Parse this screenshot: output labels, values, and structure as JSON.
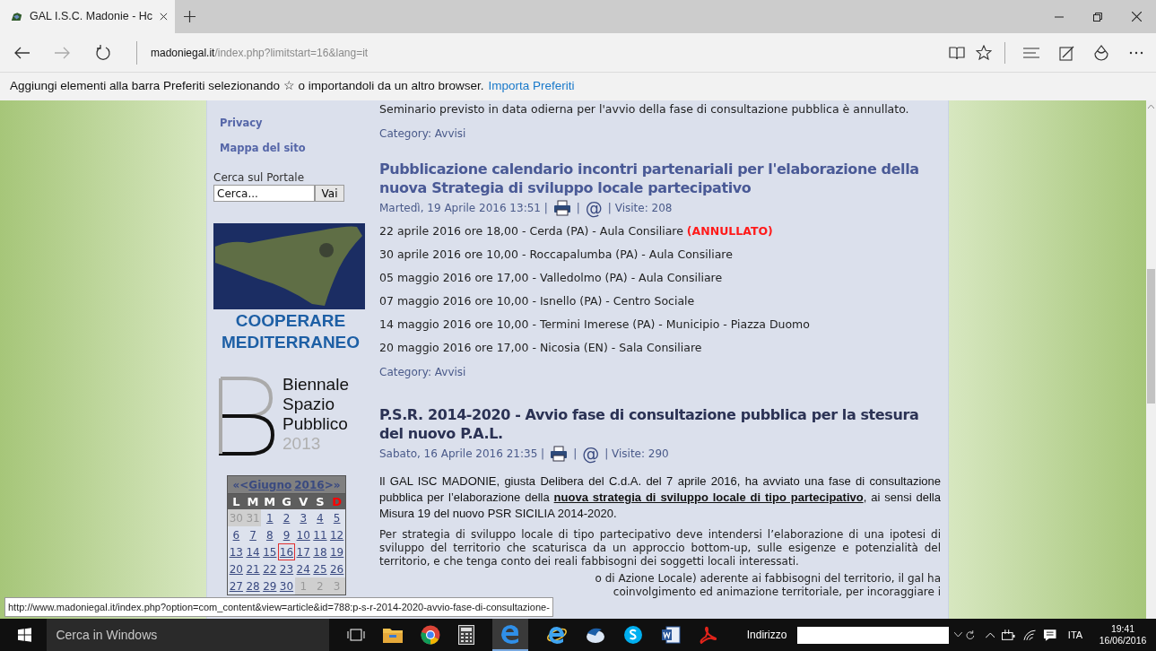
{
  "browser": {
    "tab": {
      "title": "GAL I.S.C. Madonie - Hc"
    },
    "address": {
      "domain": "madoniegal.it",
      "path": "/index.php?limitstart=16&lang=it"
    },
    "favorites_bar": {
      "message": "Aggiungi elementi alla barra Preferiti selezionando ☆ o importandoli da un altro browser.",
      "link": "Importa Preferiti"
    }
  },
  "sidebar": {
    "links": [
      "Privacy",
      "Mappa del sito"
    ],
    "search": {
      "label": "Cerca sul Portale",
      "value": "Cerca...",
      "button": "Vai"
    },
    "banner_text": "COOPERARE MEDITERRANEO",
    "biennale": {
      "lines": [
        "Biennale",
        "Spazio",
        "Pubblico"
      ],
      "year": "2013"
    },
    "calendar": {
      "nav": [
        "«",
        "<"
      ],
      "month": "Giugno",
      "year": "2016",
      "nav_end": [
        ">",
        "»"
      ],
      "weekdays": [
        {
          "label": "L",
          "color": "#ffffff"
        },
        {
          "label": "M",
          "color": "#ffffff"
        },
        {
          "label": "M",
          "color": "#ffffff"
        },
        {
          "label": "G",
          "color": "#ffffff"
        },
        {
          "label": "V",
          "color": "#ffffff"
        },
        {
          "label": "S",
          "color": "#ffffff"
        },
        {
          "label": "D",
          "color": "#ff0000"
        }
      ],
      "weeks": [
        [
          {
            "day": "30",
            "kind": "other",
            "selected": false
          },
          {
            "day": "31",
            "kind": "other",
            "selected": false
          },
          {
            "day": "1",
            "kind": "current",
            "selected": false
          },
          {
            "day": "2",
            "kind": "current",
            "selected": false
          },
          {
            "day": "3",
            "kind": "current",
            "selected": false
          },
          {
            "day": "4",
            "kind": "current",
            "selected": false
          },
          {
            "day": "5",
            "kind": "current",
            "selected": false
          }
        ],
        [
          {
            "day": "6",
            "kind": "current",
            "selected": false
          },
          {
            "day": "7",
            "kind": "current",
            "selected": false
          },
          {
            "day": "8",
            "kind": "current",
            "selected": false
          },
          {
            "day": "9",
            "kind": "current",
            "selected": false
          },
          {
            "day": "10",
            "kind": "current",
            "selected": false
          },
          {
            "day": "11",
            "kind": "current",
            "selected": false
          },
          {
            "day": "12",
            "kind": "current",
            "selected": false
          }
        ],
        [
          {
            "day": "13",
            "kind": "current",
            "selected": false
          },
          {
            "day": "14",
            "kind": "current",
            "selected": false
          },
          {
            "day": "15",
            "kind": "current",
            "selected": false
          },
          {
            "day": "16",
            "kind": "current",
            "selected": true
          },
          {
            "day": "17",
            "kind": "current",
            "selected": false
          },
          {
            "day": "18",
            "kind": "current",
            "selected": false
          },
          {
            "day": "19",
            "kind": "current",
            "selected": false
          }
        ],
        [
          {
            "day": "20",
            "kind": "current",
            "selected": false
          },
          {
            "day": "21",
            "kind": "current",
            "selected": false
          },
          {
            "day": "22",
            "kind": "current",
            "selected": false
          },
          {
            "day": "23",
            "kind": "current",
            "selected": false
          },
          {
            "day": "24",
            "kind": "current",
            "selected": false
          },
          {
            "day": "25",
            "kind": "current",
            "selected": false
          },
          {
            "day": "26",
            "kind": "current",
            "selected": false
          }
        ],
        [
          {
            "day": "27",
            "kind": "current",
            "selected": false
          },
          {
            "day": "28",
            "kind": "current",
            "selected": false
          },
          {
            "day": "29",
            "kind": "current",
            "selected": false
          },
          {
            "day": "30",
            "kind": "current",
            "selected": false
          },
          {
            "day": "1",
            "kind": "other",
            "selected": false
          },
          {
            "day": "2",
            "kind": "other",
            "selected": false
          },
          {
            "day": "3",
            "kind": "other",
            "selected": false
          }
        ]
      ]
    }
  },
  "articles": [
    {
      "body_tail": "Seminario previsto in data odierna per l'avvio della fase di consultazione pubblica è annullato.",
      "category": "Category: Avvisi"
    },
    {
      "title": "Pubblicazione calendario incontri partenariali per l'elaborazione della nuova Strategia di sviluppo locale partecipativo",
      "hovered": false,
      "meta": [
        {
          "kind": "text",
          "text": "Martedì, 19 Aprile 2016 13:51 |"
        },
        {
          "kind": "print"
        },
        {
          "kind": "text",
          "text": "|"
        },
        {
          "kind": "email",
          "text": "@"
        },
        {
          "kind": "text",
          "text": "| Visite: 208"
        }
      ],
      "meetings": [
        {
          "text": "22 aprile 2016 ore 18,00 - Cerda (PA) - Aula Consiliare",
          "note": "(ANNULLATO)"
        },
        {
          "text": "30 aprile 2016 ore 10,00 - Roccapalumba (PA) - Aula Consiliare"
        },
        {
          "text": "05 maggio 2016 ore 17,00 - Valledolmo (PA) - Aula Consiliare"
        },
        {
          "text": "07 maggio 2016 ore 10,00 - Isnello (PA) - Centro Sociale"
        },
        {
          "text": "14 maggio 2016 ore 10,00 - Termini Imerese (PA) - Municipio - Piazza Duomo"
        },
        {
          "text": "20 maggio 2016 ore 17,00 - Nicosia (EN) - Sala Consiliare"
        }
      ],
      "category": "Category: Avvisi"
    },
    {
      "title": "P.S.R. 2014-2020 - Avvio fase di consultazione pubblica per la stesura del nuovo P.A.L.",
      "hovered": true,
      "meta": [
        {
          "kind": "text",
          "text": "Sabato, 16 Aprile 2016 21:35 |"
        },
        {
          "kind": "print"
        },
        {
          "kind": "text",
          "text": "|"
        },
        {
          "kind": "email",
          "text": "@"
        },
        {
          "kind": "text",
          "text": "| Visite: 290"
        }
      ],
      "lead": {
        "before": "Il GAL ISC MADONIE, giusta Delibera del C.d.A. del 7 aprile 2016, ha avviato una fase di consultazione pubblica per l’elaborazione della",
        "link": "nuova strategia di sviluppo locale di tipo partecipativo",
        "after": ", ai sensi della Misura 19 del nuovo PSR SICILIA 2014-2020."
      },
      "paragraph": "Per strategia di sviluppo locale di tipo partecipativo deve intendersi l’elaborazione di una ipotesi di sviluppo del territorio che scaturisca da un approccio bottom-up, sulle esigenze e potenzialità del territorio, e che tenga conto dei reali fabbisogni dei soggetti locali interessati.",
      "tail_lines": [
        "o di Azione Locale) aderente ai fabbisogni del territorio, il gal ha",
        "coinvolgimento ed animazione territoriale, per incoraggiare i"
      ]
    }
  ],
  "status_url": "http://www.madoniegal.it/index.php?option=com_content&view=article&id=788:p-s-r-2014-2020-avvio-fase-di-consultazione-",
  "taskbar": {
    "search_placeholder": "Cerca in Windows",
    "address_label": "Indirizzo",
    "language": "ITA",
    "time": "19:41",
    "date": "16/06/2016"
  }
}
